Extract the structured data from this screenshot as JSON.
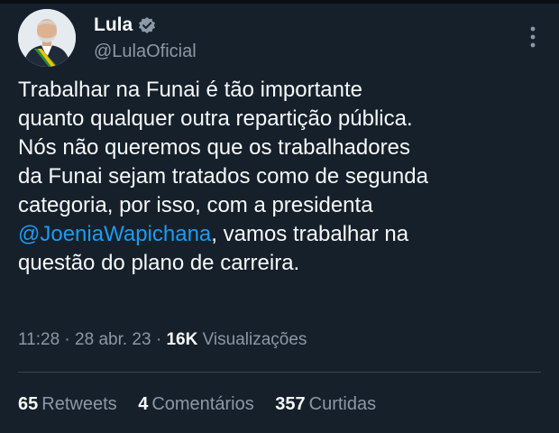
{
  "author": {
    "name": "Lula",
    "handle": "@LulaOficial",
    "verified_icon": "verified-badge-icon",
    "avatar_icon": "avatar"
  },
  "tweet": {
    "lines": [
      "Trabalhar na Funai é tão importante",
      "quanto qualquer outra repartição pública.",
      "Nós não queremos que os trabalhadores",
      "da Funai sejam tratados como de segunda",
      "categoria, por isso, com a presidenta"
    ],
    "mention": "@JoeniaWapichana",
    "after_mention": ", vamos trabalhar na",
    "last_line": "questão do plano de carreira."
  },
  "meta": {
    "time": "11:28",
    "sep1": " · ",
    "date": "28 abr. 23",
    "sep2": " · ",
    "views_count": "16K",
    "views_label": " Visualizações"
  },
  "stats": {
    "retweets_count": "65",
    "retweets_label": "Retweets",
    "comments_count": "4",
    "comments_label": "Comentários",
    "likes_count": "357",
    "likes_label": "Curtidas"
  },
  "colors": {
    "background": "#15202b",
    "text": "#f7f9f9",
    "muted": "#8b98a5",
    "accent": "#1d9bf0",
    "divider": "#38444d"
  }
}
